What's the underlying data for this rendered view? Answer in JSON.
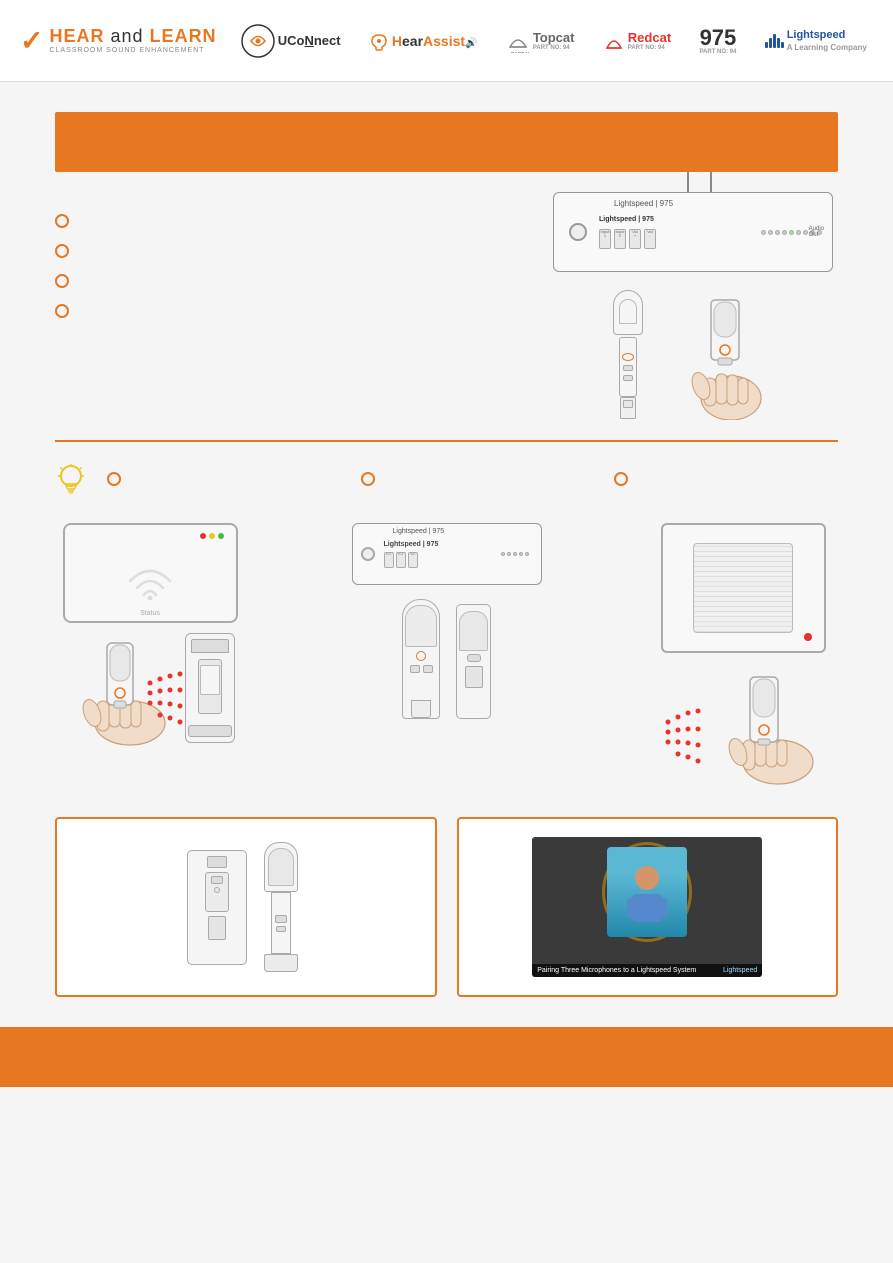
{
  "header": {
    "logo_title_part1": "HEAR",
    "logo_title_and": "and",
    "logo_title_part2": "LEARN",
    "logo_subtitle": "CLASSROOM SOUND ENHANCEMENT",
    "brands": [
      {
        "name": "UCoNnect",
        "key": "uconnect"
      },
      {
        "name": "HearAssist",
        "key": "hearassist"
      },
      {
        "name": "Topcat",
        "key": "topcat"
      },
      {
        "name": "Redcat",
        "key": "redcat"
      },
      {
        "name": "975",
        "key": "nine75"
      },
      {
        "name": "Lightspeed",
        "key": "lightspeed"
      }
    ]
  },
  "banner": {
    "text": ""
  },
  "section1": {
    "bullets": [
      {
        "text": ""
      },
      {
        "text": ""
      },
      {
        "text": ""
      },
      {
        "text": ""
      }
    ]
  },
  "section_tip": {
    "tip_label": "TIP",
    "bullet1": "",
    "bullet2": "",
    "bullet3": ""
  },
  "section_diagrams": {
    "caption1": "",
    "caption2": "",
    "caption3": ""
  },
  "section_bottom": {
    "box1_title": "",
    "box2_title": "",
    "video_caption": "Pairing Three Microphones to a Lightspeed System",
    "video_logo": "Lightspeed"
  },
  "footer": {}
}
